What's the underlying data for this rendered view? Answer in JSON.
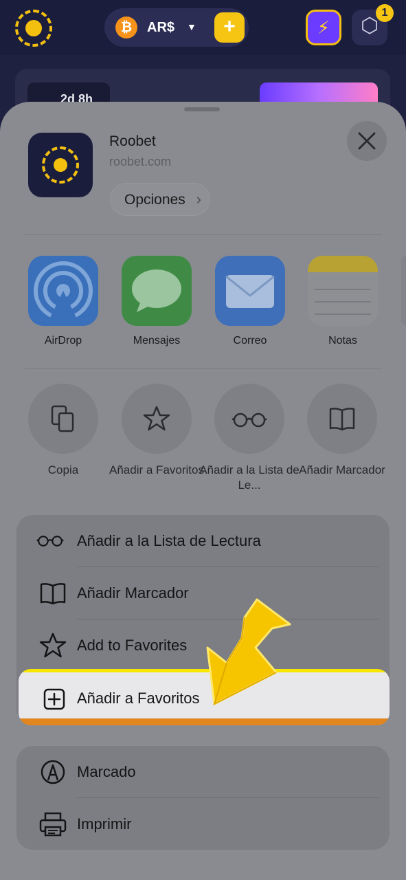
{
  "background_app": {
    "currency": "AR$",
    "notification_count": "1",
    "timer_text": "2d 8h",
    "colors": {
      "brand_yellow": "#f3c010",
      "nav_bg": "#1b1d3d"
    },
    "icons": [
      "roobet-logo-icon",
      "bitcoin-icon",
      "chevron-down-icon",
      "plus-icon",
      "lightning-icon",
      "hexagon-icon",
      "alarm-icon"
    ]
  },
  "share_sheet": {
    "site_name": "Roobet",
    "site_url": "roobet.com",
    "options_label": "Opciones",
    "apps": [
      {
        "label": "AirDrop",
        "icon": "airdrop-icon"
      },
      {
        "label": "Mensajes",
        "icon": "messages-icon"
      },
      {
        "label": "Correo",
        "icon": "mail-icon"
      },
      {
        "label": "Notas",
        "icon": "notes-icon"
      }
    ],
    "actions": [
      {
        "label": "Copia",
        "icon": "copy-icon"
      },
      {
        "label": "Añadir a Favoritos",
        "icon": "star-icon"
      },
      {
        "label": "Añadir a la Lista de Le...",
        "icon": "glasses-icon"
      },
      {
        "label": "Añadir Marcador",
        "icon": "book-icon"
      }
    ],
    "list_group_1": [
      {
        "label": "Añadir a la Lista de Lectura",
        "icon": "glasses-icon"
      },
      {
        "label": "Añadir Marcador",
        "icon": "book-icon"
      },
      {
        "label": "Add to Favorites",
        "icon": "star-icon"
      },
      {
        "label": "Añadir a Favoritos",
        "icon": "plus-square-icon",
        "highlighted": true
      }
    ],
    "list_group_2": [
      {
        "label": "Marcado",
        "icon": "markup-icon"
      },
      {
        "label": "Imprimir",
        "icon": "printer-icon"
      }
    ]
  },
  "annotation": {
    "icon": "yellow-arrow-pointer-icon",
    "color": "#f7c400"
  }
}
